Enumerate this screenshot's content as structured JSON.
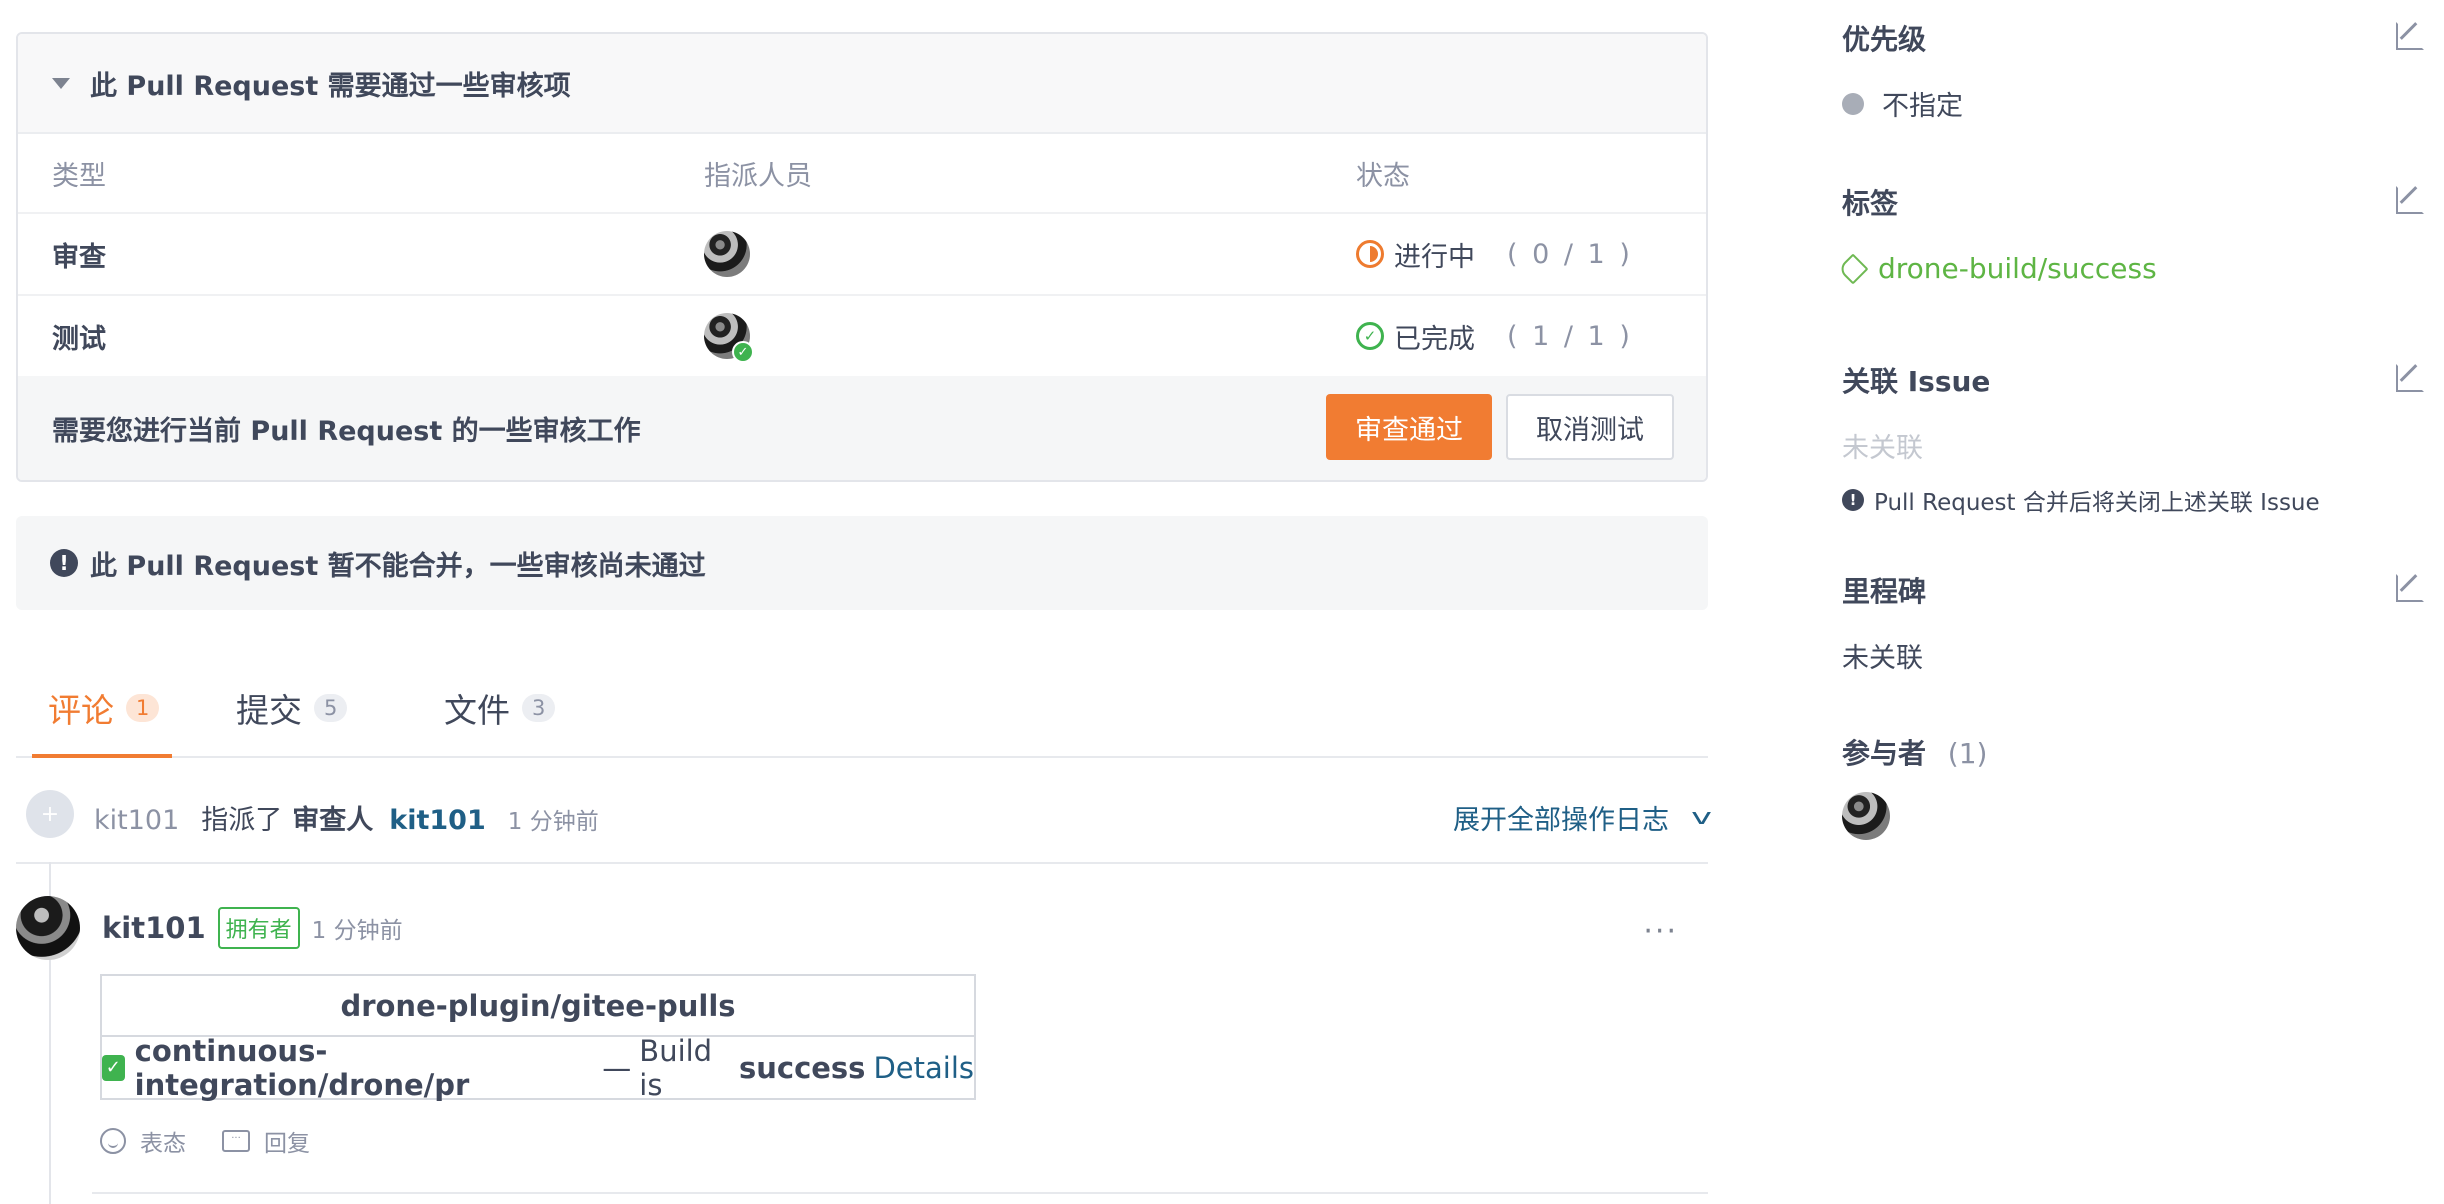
{
  "review": {
    "title": "此 Pull Request 需要通过一些审核项",
    "columns": [
      "类型",
      "指派人员",
      "状态"
    ],
    "rows": [
      {
        "type": "审查",
        "status": "进行中",
        "count": "( 0 / 1 )",
        "status_color": "#ee7b2f"
      },
      {
        "type": "测试",
        "status": "已完成",
        "count": "( 1 / 1 )",
        "status_color": "#3fb34f"
      }
    ],
    "footer_text": "需要您进行当前 Pull Request 的一些审核工作",
    "approve_label": "审查通过",
    "cancel_label": "取消测试"
  },
  "merge_warning": {
    "text": "此 Pull Request 暂不能合并，一些审核尚未通过"
  },
  "tabs": [
    {
      "label": "评论",
      "count": "1"
    },
    {
      "label": "提交",
      "count": "5"
    },
    {
      "label": "文件",
      "count": "3"
    }
  ],
  "event": {
    "user": "kit101",
    "action": "指派了",
    "role": "审查人",
    "target": "kit101",
    "time": "1 分钟前",
    "expand_label": "展开全部操作日志"
  },
  "comment": {
    "author": "kit101",
    "badge": "拥有者",
    "time": "1 分钟前",
    "more": "···",
    "ci_repo": "drone-plugin/gitee-pulls",
    "ci_context": "continuous-integration/drone/pr",
    "ci_sep": "—",
    "ci_mid": "Build is",
    "ci_status": "success",
    "ci_link": "Details",
    "react_label": "表态",
    "reply_label": "回复"
  },
  "sidebar": {
    "priority": {
      "title": "优先级",
      "value": "不指定"
    },
    "labels": {
      "title": "标签",
      "value": "drone-build/success"
    },
    "issue": {
      "title": "关联 Issue",
      "value": "未关联",
      "note": "Pull Request 合并后将关闭上述关联 Issue"
    },
    "milestone": {
      "title": "里程碑",
      "value": "未关联"
    },
    "participants": {
      "title": "参与者",
      "count": "(1)"
    }
  },
  "colors": {
    "accent": "#f17c32",
    "success": "#3fb34f",
    "link": "#1f5f86",
    "tag": "#5eb544"
  }
}
